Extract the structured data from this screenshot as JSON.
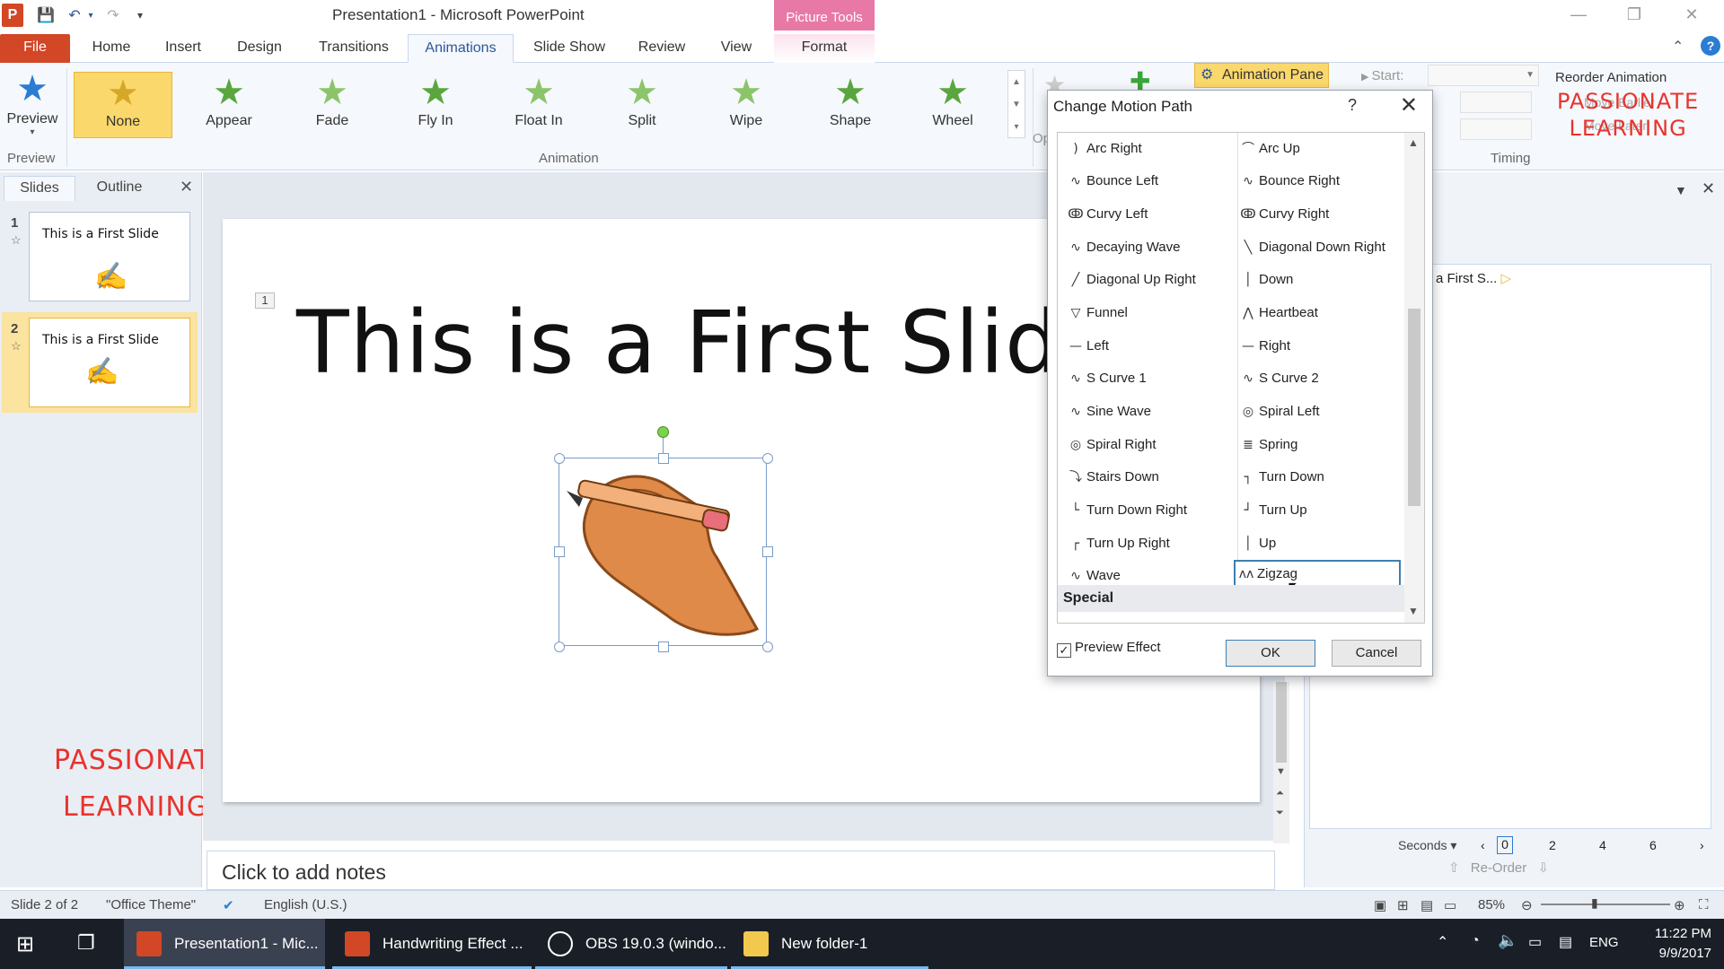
{
  "window": {
    "title": "Presentation1 - Microsoft PowerPoint",
    "picture_tools": "Picture Tools"
  },
  "ribbon": {
    "tabs": [
      "File",
      "Home",
      "Insert",
      "Design",
      "Transitions",
      "Animations",
      "Slide Show",
      "Review",
      "View",
      "Format"
    ],
    "active_tab": "Animations",
    "preview_label": "Preview",
    "preview_group": "Preview",
    "animation_group": "Animation",
    "timing_group": "Timing",
    "animations": [
      "None",
      "Appear",
      "Fade",
      "Fly In",
      "Float In",
      "Split",
      "Wipe",
      "Shape",
      "Wheel"
    ],
    "selected_animation": "None",
    "animation_pane": "Animation Pane",
    "start_label": "Start:",
    "reorder": "Reorder Animation",
    "move_earlier": "Move Earlier",
    "move_later": "Move Later",
    "options_partial": "Op"
  },
  "slides_panel": {
    "tab_slides": "Slides",
    "tab_outline": "Outline",
    "slides": [
      {
        "num": "1",
        "title": "This is a First Slide"
      },
      {
        "num": "2",
        "title": "This is a First Slide"
      }
    ]
  },
  "slide": {
    "number_badge": "1",
    "title": "This is a First Slide"
  },
  "notes": {
    "placeholder": "Click to add notes"
  },
  "anim_pane": {
    "item": "a First S...",
    "seconds": "Seconds",
    "ticks": [
      "0",
      "2",
      "4",
      "6"
    ],
    "reorder": "Re-Order"
  },
  "dialog": {
    "title": "Change Motion Path",
    "help": "?",
    "left_column": [
      {
        "label": "Arc Right",
        "icon": ")"
      },
      {
        "label": "Bounce Left",
        "icon": "∿"
      },
      {
        "label": "Curvy Left",
        "icon": "ↂ"
      },
      {
        "label": "Decaying Wave",
        "icon": "∿"
      },
      {
        "label": "Diagonal Up Right",
        "icon": "╱"
      },
      {
        "label": "Funnel",
        "icon": "▽"
      },
      {
        "label": "Left",
        "icon": "—"
      },
      {
        "label": "S Curve 1",
        "icon": "∿"
      },
      {
        "label": "Sine Wave",
        "icon": "∿"
      },
      {
        "label": "Spiral Right",
        "icon": "◎"
      },
      {
        "label": "Stairs Down",
        "icon": "⤵"
      },
      {
        "label": "Turn Down Right",
        "icon": "└"
      },
      {
        "label": "Turn Up Right",
        "icon": "┌"
      },
      {
        "label": "Wave",
        "icon": "∿"
      }
    ],
    "right_column": [
      {
        "label": "Arc Up",
        "icon": "⌒"
      },
      {
        "label": "Bounce Right",
        "icon": "∿"
      },
      {
        "label": "Curvy Right",
        "icon": "ↂ"
      },
      {
        "label": "Diagonal Down Right",
        "icon": "╲"
      },
      {
        "label": "Down",
        "icon": "│"
      },
      {
        "label": "Heartbeat",
        "icon": "⋀"
      },
      {
        "label": "Right",
        "icon": "—"
      },
      {
        "label": "S Curve 2",
        "icon": "∿"
      },
      {
        "label": "Spiral Left",
        "icon": "◎"
      },
      {
        "label": "Spring",
        "icon": "≣"
      },
      {
        "label": "Turn Down",
        "icon": "┐"
      },
      {
        "label": "Turn Up",
        "icon": "┘"
      },
      {
        "label": "Up",
        "icon": "│"
      },
      {
        "label": "Zigzag",
        "icon": "ʌʌ"
      }
    ],
    "selected": "Zigzag",
    "special_header": "Special",
    "preview_effect": "Preview Effect",
    "preview_checked": true,
    "ok": "OK",
    "cancel": "Cancel"
  },
  "status": {
    "slide": "Slide 2 of 2",
    "theme": "\"Office Theme\"",
    "language": "English (U.S.)",
    "zoom": "85%"
  },
  "taskbar": {
    "items": [
      "Presentation1 - Mic...",
      "Handwriting Effect ...",
      "OBS 19.0.3 (windo...",
      "New folder-1"
    ],
    "lang": "ENG",
    "time": "11:22 PM",
    "date": "9/9/2017"
  },
  "watermark": {
    "line1": "PASSIONATE",
    "line2": "LEARNING"
  },
  "colors": {
    "file_tab": "#d24726",
    "accent": "#2b579a",
    "picture_tools": "#e879a6",
    "watermark": "#e8332d",
    "selected_anim": "#fbd86b"
  }
}
